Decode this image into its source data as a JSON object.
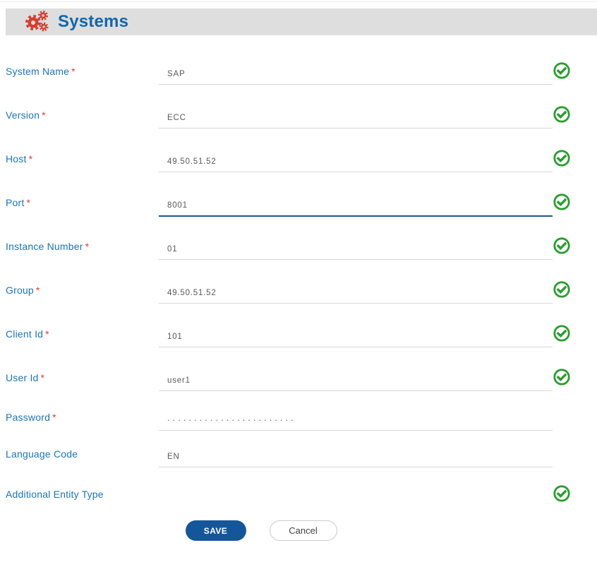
{
  "header": {
    "title": "Systems",
    "icon": "gears-icon"
  },
  "colors": {
    "header_bg": "#dedede",
    "title_blue": "#1467a8",
    "gear_red": "#d43d31",
    "label_blue": "#1d73b4",
    "required_red": "#e03c31",
    "value_gray": "#58585a",
    "underline_gray": "#d9d9d9",
    "focused_underline_blue": "#1b5688",
    "check_green": "#2a9d2f",
    "save_bg": "#15569a",
    "save_text": "#ffffff",
    "cancel_border": "#cccccc",
    "cancel_text": "#444444"
  },
  "form": {
    "rows": [
      {
        "label": "System Name",
        "required": true,
        "value": "SAP",
        "checked": true,
        "underline": true,
        "focused": false,
        "masked": false
      },
      {
        "label": "Version",
        "required": true,
        "value": "ECC",
        "checked": true,
        "underline": true,
        "focused": false,
        "masked": false
      },
      {
        "label": "Host",
        "required": true,
        "value": "49.50.51.52",
        "checked": true,
        "underline": true,
        "focused": false,
        "masked": false
      },
      {
        "label": "Port",
        "required": true,
        "value": "8001",
        "checked": true,
        "underline": true,
        "focused": true,
        "masked": false
      },
      {
        "label": "Instance Number",
        "required": true,
        "value": "01",
        "checked": true,
        "underline": true,
        "focused": false,
        "masked": false
      },
      {
        "label": "Group",
        "required": true,
        "value": "49.50.51.52",
        "checked": true,
        "underline": true,
        "focused": false,
        "masked": false
      },
      {
        "label": "Client Id",
        "required": true,
        "value": "101",
        "checked": true,
        "underline": true,
        "focused": false,
        "masked": false
      },
      {
        "label": "User Id",
        "required": true,
        "value": "user1",
        "checked": true,
        "underline": true,
        "focused": false,
        "masked": false
      },
      {
        "label": "Password",
        "required": true,
        "value": "........................",
        "checked": false,
        "underline": true,
        "focused": false,
        "masked": true
      },
      {
        "label": "Language Code",
        "required": false,
        "value": "EN",
        "checked": false,
        "underline": true,
        "focused": false,
        "masked": false
      },
      {
        "label": "Additional Entity Type",
        "required": false,
        "value": "",
        "checked": true,
        "underline": false,
        "focused": false,
        "masked": false
      }
    ]
  },
  "actions": {
    "save_label": "SAVE",
    "cancel_label": "Cancel"
  }
}
